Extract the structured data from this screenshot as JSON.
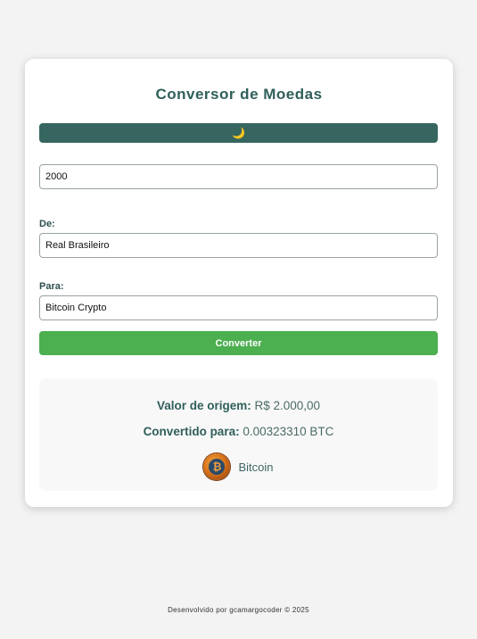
{
  "title": "Conversor de Moedas",
  "theme_toggle": {
    "icon": "moon-icon",
    "glyph": "🌙"
  },
  "amount_input": {
    "value": "2000"
  },
  "from": {
    "label": "De:",
    "selected": "Real Brasileiro"
  },
  "to": {
    "label": "Para:",
    "selected": "Bitcoin Crypto"
  },
  "convert_button": {
    "label": "Converter"
  },
  "result": {
    "origin_label": "Valor de origem:",
    "origin_value": "R$ 2.000,00",
    "converted_label": "Convertido para:",
    "converted_value": "0.00323310 BTC",
    "coin_icon": "bitcoin-coin-icon",
    "coin_glyph": "₿",
    "coin_name": "Bitcoin"
  },
  "footer": {
    "text": "Desenvolvido por gcamargocoder © 2025"
  },
  "colors": {
    "primary": "#376661",
    "accent": "#4caf50",
    "title": "#2f5f5a"
  }
}
